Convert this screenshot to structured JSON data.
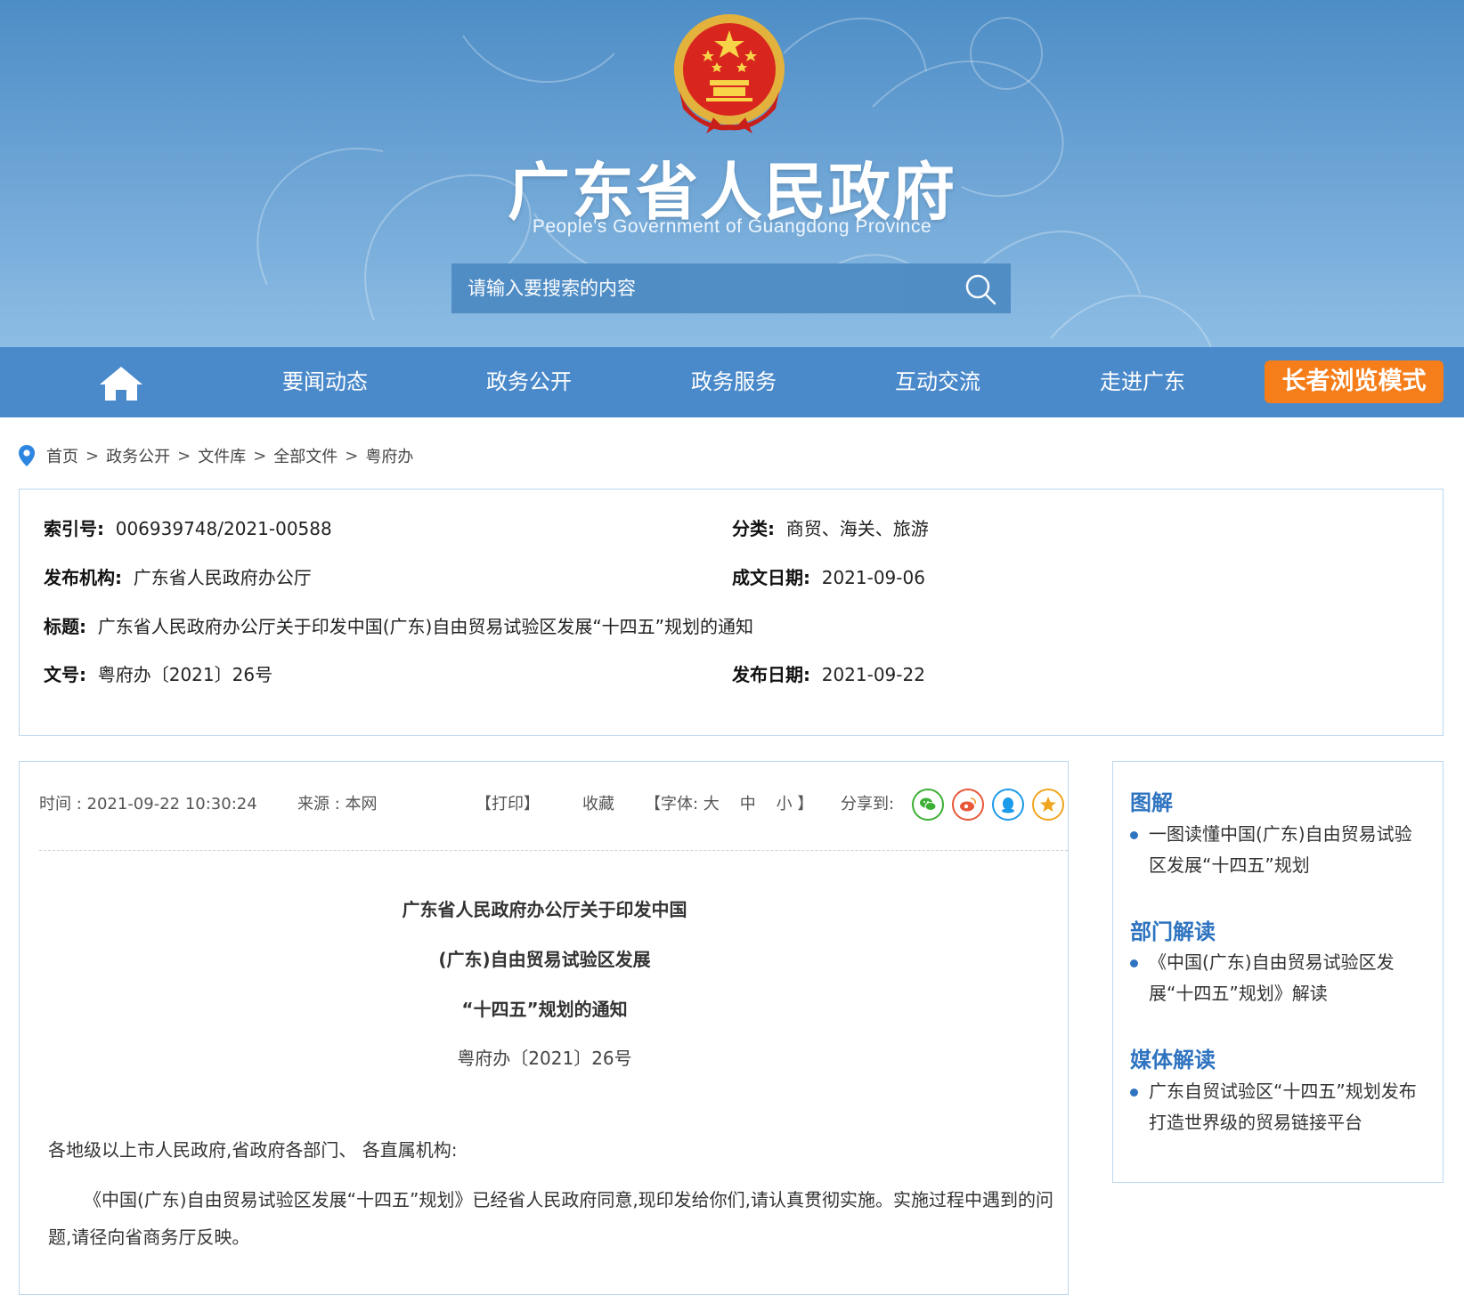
{
  "header": {
    "title": "广东省人民政府",
    "subtitle": "People's Government of Guangdong Province",
    "search_placeholder": "请输入要搜索的内容"
  },
  "nav": {
    "items": [
      "要闻动态",
      "政务公开",
      "政务服务",
      "互动交流",
      "走进广东"
    ],
    "elder_mode": "长者浏览模式"
  },
  "breadcrumb": [
    "首页",
    "政务公开",
    "文件库",
    "全部文件",
    "粤府办"
  ],
  "meta": {
    "index_label": "索引号:",
    "index_value": "006939748/2021-00588",
    "category_label": "分类:",
    "category_value": "商贸、海关、旅游",
    "issuer_label": "发布机构:",
    "issuer_value": "广东省人民政府办公厅",
    "written_date_label": "成文日期:",
    "written_date_value": "2021-09-06",
    "title_label": "标题:",
    "title_value": "广东省人民政府办公厅关于印发中国(广东)自由贸易试验区发展“十四五”规划的通知",
    "doc_no_label": "文号:",
    "doc_no_value": "粤府办〔2021〕26号",
    "publish_date_label": "发布日期:",
    "publish_date_value": "2021-09-22"
  },
  "toolbar": {
    "time": "时间 : 2021-09-22 10:30:24",
    "source": "来源 : 本网",
    "print": "【打印】",
    "favorite": "收藏",
    "font_prefix": "【字体: ",
    "font_large": "大",
    "font_medium": "中",
    "font_small": "小",
    "font_suffix": "】",
    "share_label": "分享到:"
  },
  "article": {
    "title_lines": [
      "广东省人民政府办公厅关于印发中国",
      "(广东)自由贸易试验区发展",
      "“十四五”规划的通知"
    ],
    "doc_no": "粤府办〔2021〕26号",
    "salutation": "各地级以上市人民政府,省政府各部门、 各直属机构:",
    "paragraph": "《中国(广东)自由贸易试验区发展“十四五”规划》已经省人民政府同意,现印发给你们,请认真贯彻实施。实施过程中遇到的问题,请径向省商务厅反映。"
  },
  "sidebar": {
    "sections": [
      {
        "heading": "图解",
        "item": "一图读懂中国(广东)自由贸易试验区发展“十四五”规划"
      },
      {
        "heading": "部门解读",
        "item": "《中国(广东)自由贸易试验区发展“十四五”规划》解读"
      },
      {
        "heading": "媒体解读",
        "item": "广东自贸试验区“十四五”规划发布 打造世界级的贸易链接平台"
      }
    ]
  },
  "colors": {
    "banner": "#5b97ce",
    "nav": "#4a8acb",
    "elder_button": "#f57d1a",
    "heading_blue": "#2f74c0",
    "border": "#bcd7ee"
  }
}
